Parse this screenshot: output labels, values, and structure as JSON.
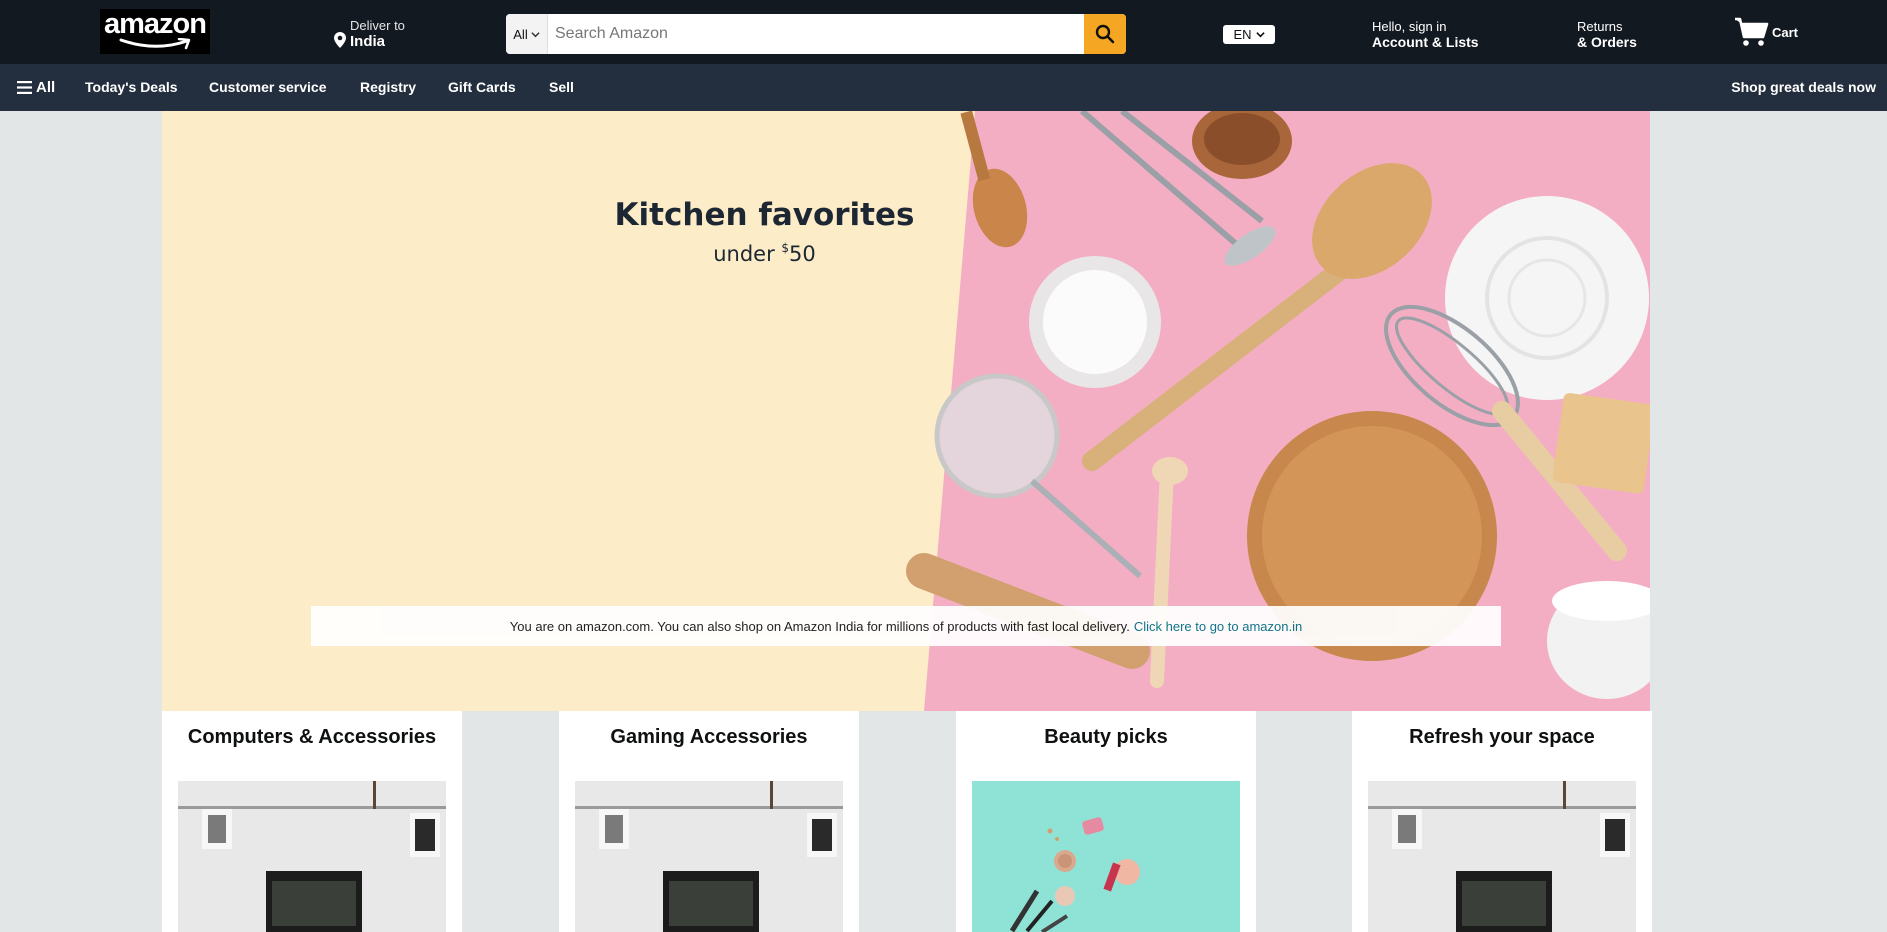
{
  "header": {
    "logo_text": "amazon",
    "deliver_line1": "Deliver to",
    "deliver_line2": "India",
    "search": {
      "category": "All",
      "placeholder": "Search Amazon"
    },
    "language": "EN",
    "account_line1": "Hello, sign in",
    "account_line2": "Account & Lists",
    "orders_line1": "Returns",
    "orders_line2": "& Orders",
    "cart_label": "Cart"
  },
  "nav": {
    "all_label": "All",
    "items": [
      "Today's Deals",
      "Customer service",
      "Registry",
      "Gift Cards",
      "Sell"
    ],
    "right_label": "Shop great deals now"
  },
  "hero": {
    "title": "Kitchen favorites",
    "subtitle_prefix": "under ",
    "subtitle_currency": "$",
    "subtitle_amount": "50"
  },
  "notice": {
    "text": "You are on amazon.com. You can also shop on Amazon India for millions of products with fast local delivery.",
    "link": "Click here to go to amazon.in"
  },
  "cards": [
    {
      "title": "Computers & Accessories",
      "image": "desk-setup"
    },
    {
      "title": "Gaming Accessories",
      "image": "desk-setup"
    },
    {
      "title": "Beauty picks",
      "image": "makeup-flatlay"
    },
    {
      "title": "Refresh your space",
      "image": "desk-setup"
    }
  ],
  "colors": {
    "topbar": "#131921",
    "navbar": "#232f3e",
    "search_button": "#febd69",
    "hero_left": "#fdecc8",
    "hero_right": "#f4aec4",
    "link": "#007185"
  }
}
